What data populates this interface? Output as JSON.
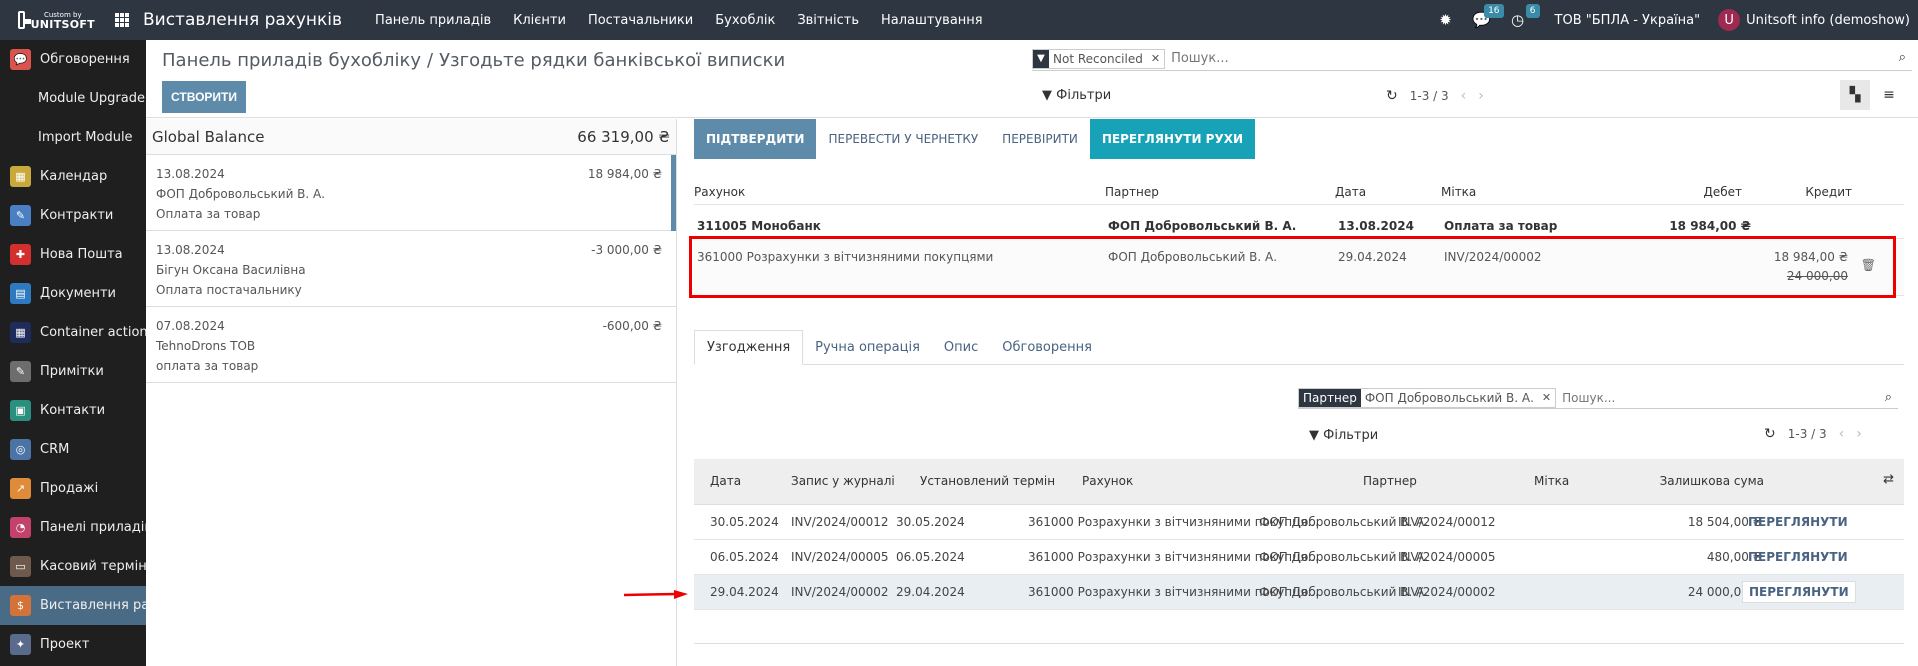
{
  "navbar": {
    "logo_small": "Custom by",
    "logo_big": "UNITSOFT",
    "app_title": "Виставлення рахунків",
    "menu": [
      "Панель приладів",
      "Клієнти",
      "Постачальники",
      "Бухоблік",
      "Звітність",
      "Налаштування"
    ],
    "messages_count": "16",
    "activities_count": "6",
    "company": "ТОВ \"БПЛА - Україна\"",
    "avatar_letter": "U",
    "user": "Unitsoft info (demoshow)"
  },
  "sidebar": {
    "items": [
      {
        "label": "Обговорення",
        "icon": "chat-icon",
        "color": "#d9534f",
        "glyph": "💬"
      },
      {
        "label": "Module Upgrade",
        "icon": "",
        "color": "",
        "glyph": ""
      },
      {
        "label": "Import Module",
        "icon": "",
        "color": "",
        "glyph": ""
      },
      {
        "label": "Календар",
        "icon": "calendar-icon",
        "color": "#c9a93c",
        "glyph": "▦"
      },
      {
        "label": "Контракти",
        "icon": "contract-icon",
        "color": "#4a7fc4",
        "glyph": "✎"
      },
      {
        "label": "Нова Пошта",
        "icon": "nova-poshta-icon",
        "color": "#d32f2f",
        "glyph": "✚"
      },
      {
        "label": "Документи",
        "icon": "documents-icon",
        "color": "#2d7ac0",
        "glyph": "▤"
      },
      {
        "label": "Container actions",
        "icon": "container-icon",
        "color": "#1f2b5a",
        "glyph": "▦"
      },
      {
        "label": "Примітки",
        "icon": "notes-icon",
        "color": "#6d6d6d",
        "glyph": "✎"
      },
      {
        "label": "Контакти",
        "icon": "contacts-icon",
        "color": "#2a8f7e",
        "glyph": "▣"
      },
      {
        "label": "CRM",
        "icon": "crm-icon",
        "color": "#4b73a6",
        "glyph": "◎"
      },
      {
        "label": "Продажі",
        "icon": "sales-icon",
        "color": "#e08b3a",
        "glyph": "↗"
      },
      {
        "label": "Панелі приладів",
        "icon": "dashboards-icon",
        "color": "#c2426b",
        "glyph": "◔"
      },
      {
        "label": "Касовий термін...",
        "icon": "pos-icon",
        "color": "#6d5a4d",
        "glyph": "▭"
      },
      {
        "label": "Виставлення ра...",
        "icon": "invoicing-icon",
        "color": "#d3733a",
        "glyph": "$"
      },
      {
        "label": "Проект",
        "icon": "project-icon",
        "color": "#5a6a8c",
        "glyph": "✦"
      }
    ],
    "active_index": 14
  },
  "control": {
    "breadcrumb_parent": "Панель приладів бухобліку",
    "breadcrumb_sep": "/",
    "breadcrumb_current": "Узгодьте рядки банківської виписки",
    "create_label": "СТВОРИТИ",
    "facet_value": "Not Reconciled",
    "search_placeholder": "Пошук...",
    "filters_label": "Фільтри",
    "pager": "1-3 / 3"
  },
  "statements": {
    "title": "Global Balance",
    "total": "66 319,00 ₴",
    "lines": [
      {
        "date": "13.08.2024",
        "partner": "ФОП Добровольський В. А.",
        "label": "Оплата за товар",
        "amount": "18 984,00 ₴"
      },
      {
        "date": "13.08.2024",
        "partner": "Бігун Оксана Василівна",
        "label": "Оплата постачальнику",
        "amount": "-3 000,00 ₴"
      },
      {
        "date": "07.08.2024",
        "partner": "TehnoDrons ТОВ",
        "label": "оплата за товар",
        "amount": "-600,00 ₴"
      }
    ]
  },
  "actions": {
    "validate": "ПІДТВЕРДИТИ",
    "to_draft": "ПЕРЕВЕСТИ У ЧЕРНЕТКУ",
    "check": "ПЕРЕВІРИТИ",
    "view_moves": "ПЕРЕГЛЯНУТИ РУХИ"
  },
  "reconcile": {
    "headers": {
      "account": "Рахунок",
      "partner": "Партнер",
      "date": "Дата",
      "label": "Мітка",
      "debit": "Дебет",
      "credit": "Кредит"
    },
    "main": {
      "account": "311005 Монобанк",
      "partner": "ФОП Добровольський В. А.",
      "date": "13.08.2024",
      "label": "Оплата за товар",
      "debit": "18 984,00 ₴"
    },
    "line": {
      "account": "361000 Розрахунки з вітчизняними покупцями",
      "partner": "ФОП Добровольський В. А.",
      "date": "29.04.2024",
      "label": "INV/2024/00002",
      "credit": "18 984,00 ₴",
      "credit_original": "24 000,00"
    }
  },
  "tabs": [
    "Узгодження",
    "Ручна операція",
    "Опис",
    "Обговорення"
  ],
  "sub_search": {
    "facet_label": "Партнер",
    "facet_value": "ФОП Добровольський В. А.",
    "placeholder": "Пошук...",
    "filters_label": "Фільтри",
    "pager": "1-3 / 3"
  },
  "grid": {
    "headers": {
      "date": "Дата",
      "journal": "Запис у журналі",
      "due": "Установлений термін",
      "account": "Рахунок",
      "partner": "Партнер",
      "label": "Мітка",
      "residual": "Залишкова сума"
    },
    "view_label": "ПЕРЕГЛЯНУТИ",
    "rows": [
      {
        "date": "30.05.2024",
        "journal": "INV/2024/00012",
        "due": "30.05.2024",
        "account": "361000 Розрахунки з вітчизняними покупця...",
        "partner": "ФОП Добровольський В. А.",
        "label": "INV/2024/00012",
        "residual": "18 504,00 ₴"
      },
      {
        "date": "06.05.2024",
        "journal": "INV/2024/00005",
        "due": "06.05.2024",
        "account": "361000 Розрахунки з вітчизняними покупця...",
        "partner": "ФОП Добровольський В. А.",
        "label": "INV/2024/00005",
        "residual": "480,00 ₴"
      },
      {
        "date": "29.04.2024",
        "journal": "INV/2024/00002",
        "due": "29.04.2024",
        "account": "361000 Розрахунки з вітчизняними покупця...",
        "partner": "ФОП Добровольський В. А.",
        "label": "INV/2024/00002",
        "residual": "24 000,00 ₴"
      }
    ],
    "selected_index": 2
  }
}
